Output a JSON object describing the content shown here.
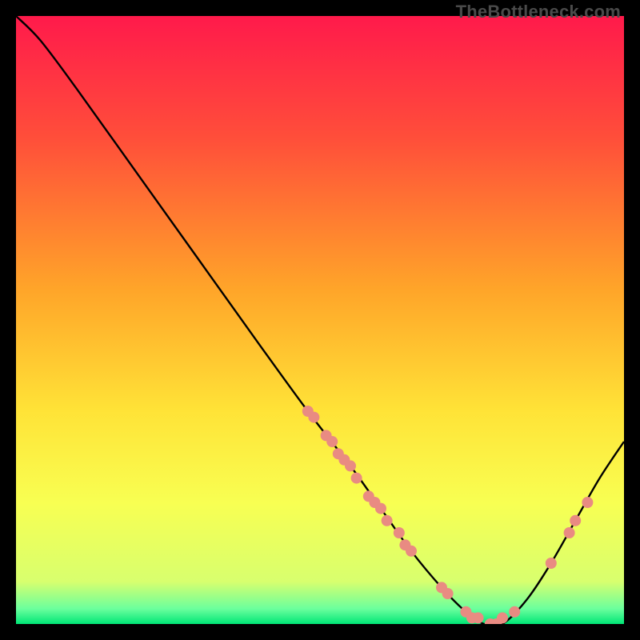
{
  "watermark": "TheBottleneck.com",
  "chart_data": {
    "type": "line",
    "title": "",
    "xlabel": "",
    "ylabel": "",
    "xlim": [
      0,
      100
    ],
    "ylim": [
      0,
      100
    ],
    "grid": false,
    "legend": false,
    "background_gradient_stops": [
      {
        "offset": 0.0,
        "color": "#ff1a4b"
      },
      {
        "offset": 0.2,
        "color": "#ff4e3a"
      },
      {
        "offset": 0.45,
        "color": "#ffa529"
      },
      {
        "offset": 0.65,
        "color": "#ffe337"
      },
      {
        "offset": 0.8,
        "color": "#f8ff52"
      },
      {
        "offset": 0.93,
        "color": "#d8ff6e"
      },
      {
        "offset": 0.975,
        "color": "#6bff9d"
      },
      {
        "offset": 1.0,
        "color": "#00e676"
      }
    ],
    "series": [
      {
        "name": "bottleneck-curve",
        "color": "#000000",
        "x": [
          0,
          4,
          10,
          20,
          30,
          40,
          48,
          55,
          60,
          65,
          70,
          74,
          77,
          80,
          84,
          88,
          92,
          96,
          100
        ],
        "y": [
          100,
          96,
          88,
          74,
          60,
          46,
          35,
          26,
          19,
          12,
          6,
          2,
          0,
          0,
          4,
          10,
          17,
          24,
          30
        ]
      }
    ],
    "markers": {
      "name": "highlight-dots",
      "color": "#e98b82",
      "radius": 7,
      "points": [
        {
          "x": 48,
          "y": 35
        },
        {
          "x": 49,
          "y": 34
        },
        {
          "x": 51,
          "y": 31
        },
        {
          "x": 52,
          "y": 30
        },
        {
          "x": 53,
          "y": 28
        },
        {
          "x": 54,
          "y": 27
        },
        {
          "x": 55,
          "y": 26
        },
        {
          "x": 56,
          "y": 24
        },
        {
          "x": 58,
          "y": 21
        },
        {
          "x": 59,
          "y": 20
        },
        {
          "x": 60,
          "y": 19
        },
        {
          "x": 61,
          "y": 17
        },
        {
          "x": 63,
          "y": 15
        },
        {
          "x": 64,
          "y": 13
        },
        {
          "x": 65,
          "y": 12
        },
        {
          "x": 70,
          "y": 6
        },
        {
          "x": 71,
          "y": 5
        },
        {
          "x": 74,
          "y": 2
        },
        {
          "x": 75,
          "y": 1
        },
        {
          "x": 76,
          "y": 1
        },
        {
          "x": 78,
          "y": 0
        },
        {
          "x": 79,
          "y": 0
        },
        {
          "x": 80,
          "y": 1
        },
        {
          "x": 82,
          "y": 2
        },
        {
          "x": 88,
          "y": 10
        },
        {
          "x": 91,
          "y": 15
        },
        {
          "x": 92,
          "y": 17
        },
        {
          "x": 94,
          "y": 20
        }
      ]
    }
  }
}
